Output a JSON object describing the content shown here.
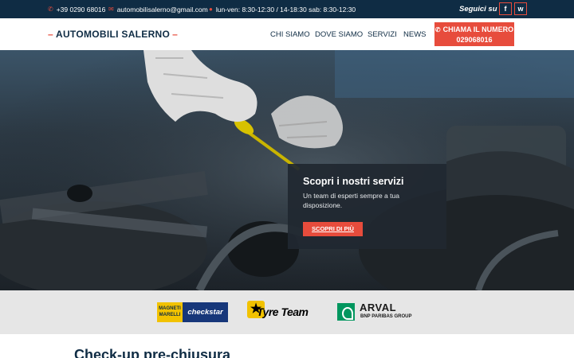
{
  "topbar": {
    "phone": "+39 0290 68016",
    "email": "automobilisalerno@gmail.com",
    "hours": "lun-ven: 8:30-12:30 / 14-18:30 sab: 8:30-12:30",
    "follow_label": "Seguici su",
    "icons": [
      "phone-icon",
      "mail-icon",
      "clock-icon",
      "facebook-icon",
      "whatsapp-icon"
    ],
    "social": [
      "f",
      "w"
    ]
  },
  "header": {
    "logo": "AUTOMOBILI SALERNO",
    "nav": [
      "CHI SIAMO",
      "DOVE SIAMO",
      "SERVIZI",
      "NEWS"
    ],
    "call_label": "CHIAMA IL NUMERO",
    "call_number": "029068016"
  },
  "hero": {
    "title": "Scopri i nostri servizi",
    "text": "Un team di esperti sempre a tua disposizione.",
    "button": "SCOPRI DI PIÙ"
  },
  "partners": {
    "magneti_marelli": "MAGNETI MARELLI",
    "checkstar": "checkstar",
    "tyre_team": "Tyre Team",
    "arval": "ARVAL",
    "arval_sub": "BNP PARIBAS GROUP"
  },
  "section": {
    "title": "Check-up pre-chiusura"
  },
  "colors": {
    "navy": "#0f2c44",
    "accent": "#e74c3c",
    "partners_bg": "#e6e6e6"
  }
}
